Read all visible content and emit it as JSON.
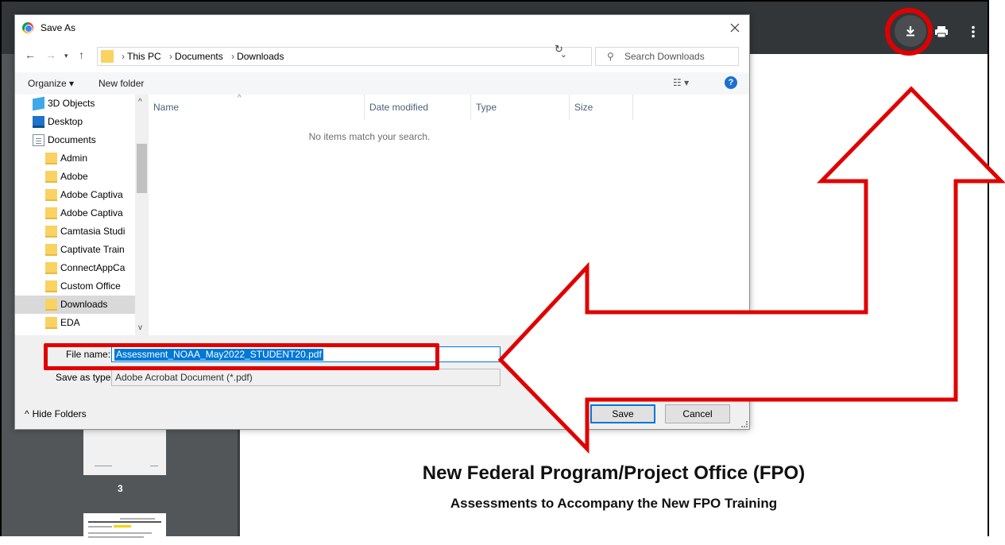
{
  "dialog": {
    "title": "Save As",
    "breadcrumb": [
      "This PC",
      "Documents",
      "Downloads"
    ],
    "search_placeholder": "Search Downloads",
    "organize_label": "Organize ▾",
    "new_folder_label": "New folder",
    "nav_items": [
      {
        "label": "3D Objects",
        "icon": "3d-objects-icon"
      },
      {
        "label": "Desktop",
        "icon": "desktop-icon"
      },
      {
        "label": "Documents",
        "icon": "documents-icon"
      },
      {
        "label": "Admin",
        "icon": "folder-icon"
      },
      {
        "label": "Adobe",
        "icon": "folder-icon"
      },
      {
        "label": "Adobe Captiva",
        "icon": "folder-icon"
      },
      {
        "label": "Adobe Captiva",
        "icon": "folder-icon"
      },
      {
        "label": "Camtasia Studi",
        "icon": "folder-icon"
      },
      {
        "label": "Captivate Train",
        "icon": "folder-icon"
      },
      {
        "label": "ConnectAppCa",
        "icon": "folder-icon"
      },
      {
        "label": "Custom Office",
        "icon": "folder-icon"
      },
      {
        "label": "Downloads",
        "icon": "folder-icon",
        "selected": true
      },
      {
        "label": "EDA",
        "icon": "folder-icon"
      }
    ],
    "columns": [
      "Name",
      "Date modified",
      "Type",
      "Size"
    ],
    "empty_message": "No items match your search.",
    "file_name_label": "File name:",
    "file_name_value": "Assessment_NOAA_May2022_STUDENT20.pdf",
    "save_type_label": "Save as type:",
    "save_type_value": "Adobe Acrobat Document (*.pdf)",
    "hide_folders_label": "Hide Folders",
    "save_button": "Save",
    "cancel_button": "Cancel"
  },
  "viewer": {
    "thumbnail_page_number": "3",
    "doc_title": "New Federal Program/Project Office (FPO)",
    "doc_subtitle": "Assessments to Accompany the New FPO Training",
    "toolbar_icons": [
      "download-icon",
      "print-icon",
      "more-vert-icon"
    ]
  },
  "colors": {
    "annotation": "#e00000",
    "accent": "#0078d7",
    "viewer_toolbar": "#323639",
    "viewer_sidebar": "#525659",
    "folder": "#f9d262"
  }
}
